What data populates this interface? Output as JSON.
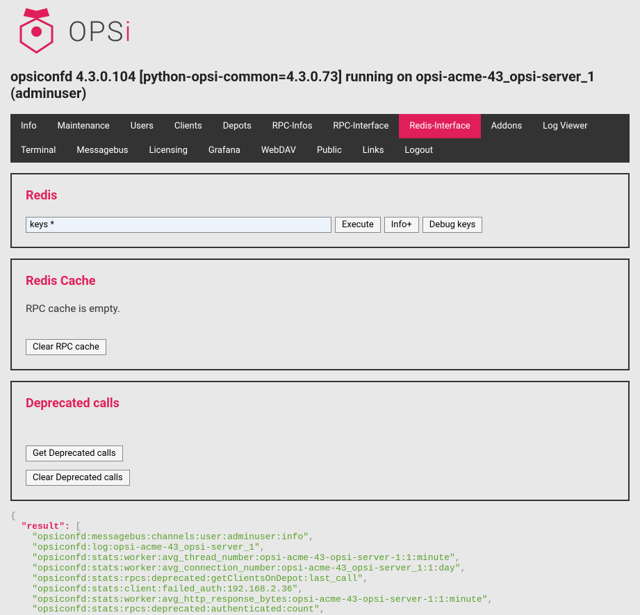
{
  "logo": {
    "text_prefix": "OPS",
    "text_suffix": "i"
  },
  "header": {
    "title": "opsiconfd 4.3.0.104 [python-opsi-common=4.3.0.73] running on opsi-acme-43_opsi-server_1 (adminuser)"
  },
  "nav": {
    "items": [
      {
        "label": "Info",
        "active": false
      },
      {
        "label": "Maintenance",
        "active": false
      },
      {
        "label": "Users",
        "active": false
      },
      {
        "label": "Clients",
        "active": false
      },
      {
        "label": "Depots",
        "active": false
      },
      {
        "label": "RPC-Infos",
        "active": false
      },
      {
        "label": "RPC-Interface",
        "active": false
      },
      {
        "label": "Redis-Interface",
        "active": true
      },
      {
        "label": "Addons",
        "active": false
      },
      {
        "label": "Log Viewer",
        "active": false
      },
      {
        "label": "Terminal",
        "active": false
      },
      {
        "label": "Messagebus",
        "active": false
      },
      {
        "label": "Licensing",
        "active": false
      },
      {
        "label": "Grafana",
        "active": false
      },
      {
        "label": "WebDAV",
        "active": false
      },
      {
        "label": "Public",
        "active": false
      },
      {
        "label": "Links",
        "active": false
      },
      {
        "label": "Logout",
        "active": false
      }
    ]
  },
  "redis": {
    "title": "Redis",
    "input_value": "keys *",
    "execute_label": "Execute",
    "info_label": "Info+",
    "debug_label": "Debug keys"
  },
  "cache": {
    "title": "Redis Cache",
    "status_text": "RPC cache is empty.",
    "clear_label": "Clear RPC cache"
  },
  "deprecated": {
    "title": "Deprecated calls",
    "get_label": "Get Deprecated calls",
    "clear_label": "Clear Deprecated calls"
  },
  "json": {
    "result_key": "\"result\":",
    "entries": [
      "\"opsiconfd:messagebus:channels:user:adminuser:info\"",
      "\"opsiconfd:log:opsi-acme-43_opsi-server_1\"",
      "\"opsiconfd:stats:worker:avg_thread_number:opsi-acme-43-opsi-server-1:1:minute\"",
      "\"opsiconfd:stats:worker:avg_connection_number:opsi-acme-43_opsi-server_1:1:day\"",
      "\"opsiconfd:stats:rpcs:deprecated:getClientsOnDepot:last_call\"",
      "\"opsiconfd:stats:client:failed_auth:192.168.2.36\"",
      "\"opsiconfd:stats:worker:avg_http_response_bytes:opsi-acme-43-opsi-server-1:1:minute\"",
      "\"opsiconfd:stats:rpcs:deprecated:authenticated:count\""
    ]
  }
}
